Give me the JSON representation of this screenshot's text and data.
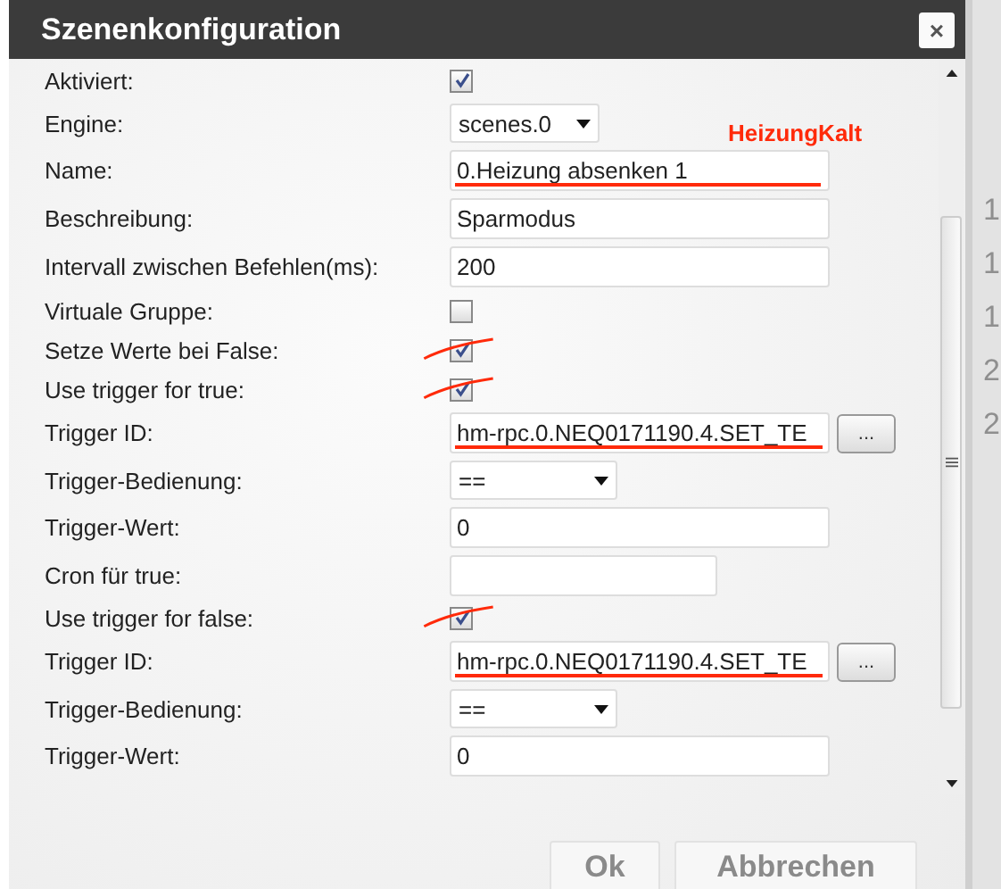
{
  "dialog": {
    "title": "Szenenkonfiguration",
    "close": "×"
  },
  "annotation": {
    "text": "HeizungKalt"
  },
  "rows": [
    {
      "kind": "checkbox",
      "label": "Aktiviert:",
      "checked": true,
      "scribbled": false
    },
    {
      "kind": "select",
      "label": "Engine:",
      "value": "scenes.0"
    },
    {
      "kind": "text",
      "label": "Name:",
      "value": "0.Heizung absenken 1",
      "struck": true
    },
    {
      "kind": "text",
      "label": "Beschreibung:",
      "value": "Sparmodus",
      "struck": false
    },
    {
      "kind": "text",
      "label": "Intervall zwischen Befehlen(ms):",
      "value": "200",
      "struck": false
    },
    {
      "kind": "checkbox",
      "label": "Virtuale Gruppe:",
      "checked": false,
      "scribbled": false
    },
    {
      "kind": "checkbox",
      "label": "Setze Werte bei False:",
      "checked": true,
      "scribbled": true
    },
    {
      "kind": "checkbox",
      "label": "Use trigger for true:",
      "checked": true,
      "scribbled": true
    },
    {
      "kind": "trigger",
      "label": "Trigger ID:",
      "value": "hm-rpc.0.NEQ0171190.4.SET_TE",
      "struck": true,
      "button": "..."
    },
    {
      "kind": "operator",
      "label": "Trigger-Bedienung:",
      "value": "=="
    },
    {
      "kind": "text",
      "label": "Trigger-Wert:",
      "value": "0",
      "struck": false
    },
    {
      "kind": "short",
      "label": "Cron für true:"
    },
    {
      "kind": "checkbox",
      "label": "Use trigger for false:",
      "checked": true,
      "scribbled": true
    },
    {
      "kind": "trigger",
      "label": "Trigger ID:",
      "value": "hm-rpc.0.NEQ0171190.4.SET_TE",
      "struck": true,
      "button": "..."
    },
    {
      "kind": "operator",
      "label": "Trigger-Bedienung:",
      "value": "=="
    },
    {
      "kind": "text",
      "label": "Trigger-Wert:",
      "value": "0",
      "struck": false
    }
  ],
  "buttons": [
    "Ok",
    "Abbrechen"
  ],
  "background": {
    "cells": [
      "1",
      "1",
      "1",
      "2",
      "2"
    ]
  }
}
